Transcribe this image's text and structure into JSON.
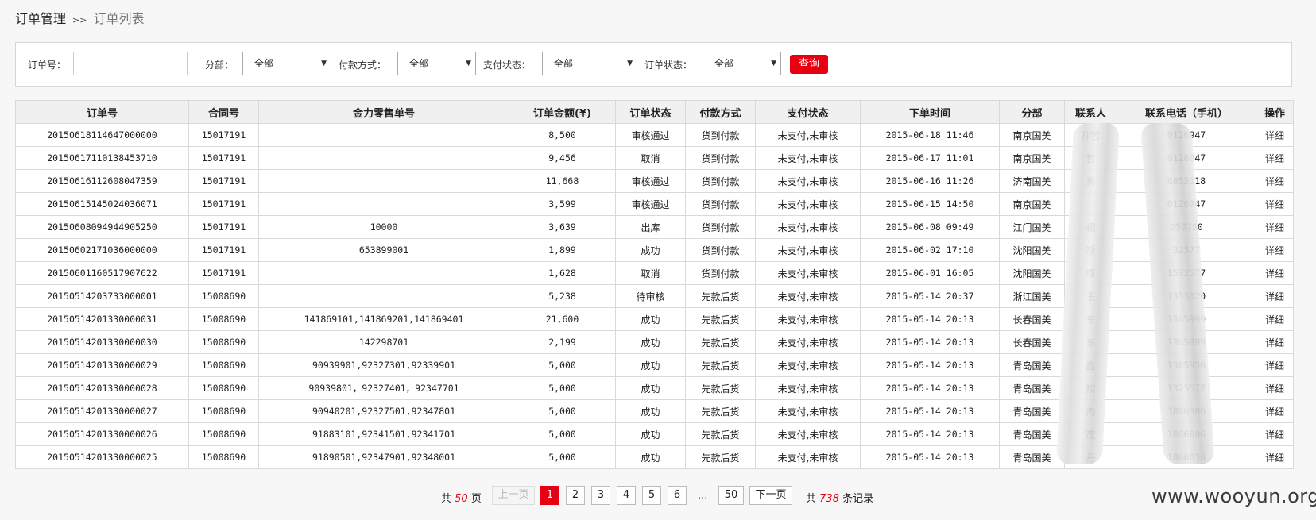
{
  "breadcrumb": {
    "parent": "订单管理",
    "separator": ">>",
    "current": "订单列表"
  },
  "filters": {
    "order_no_label": "订单号：",
    "order_no_value": "",
    "branch_label": "分部：",
    "branch_value": "全部",
    "payment_method_label": "付款方式：",
    "payment_method_value": "全部",
    "pay_status_label": "支付状态：",
    "pay_status_value": "全部",
    "order_status_label": "订单状态：",
    "order_status_value": "全部",
    "search_label": "查询"
  },
  "table": {
    "headers": [
      "订单号",
      "合同号",
      "金力零售单号",
      "订单金额(¥)",
      "订单状态",
      "付款方式",
      "支付状态",
      "下单时间",
      "分部",
      "联系人",
      "联系电话（手机）",
      "操作"
    ],
    "rows": [
      [
        "20150618114647000000",
        "15017191",
        "",
        "8,500",
        "审核通过",
        "货到付款",
        "未支付,未审核",
        "2015-06-18 11:46",
        "南京国美",
        "孙哲",
        "0126947",
        "详细"
      ],
      [
        "20150617110138453710",
        "15017191",
        "",
        "9,456",
        "取消",
        "货到付款",
        "未支付,未审核",
        "2015-06-17 11:01",
        "南京国美",
        "哲",
        "0126947",
        "详细"
      ],
      [
        "20150616112608047359",
        "15017191",
        "",
        "11,668",
        "审核通过",
        "货到付款",
        "未支付,未审核",
        "2015-06-16 11:26",
        "济南国美",
        "秀",
        "6853118",
        "详细"
      ],
      [
        "20150615145024036071",
        "15017191",
        "",
        "3,599",
        "审核通过",
        "货到付款",
        "未支付,未审核",
        "2015-06-15 14:50",
        "南京国美",
        "",
        "0126947",
        "详细"
      ],
      [
        "20150608094944905250",
        "15017191",
        "10000",
        "3,639",
        "出库",
        "货到付款",
        "未支付,未审核",
        "2015-06-08 09:49",
        "江门国美",
        "禤",
        "050730",
        "详细"
      ],
      [
        "20150602171036000000",
        "15017191",
        "653899001",
        "1,899",
        "成功",
        "货到付款",
        "未支付,未审核",
        "2015-06-02 17:10",
        "沈阳国美",
        "项",
        "32577",
        "详细"
      ],
      [
        "20150601160517907622",
        "15017191",
        "",
        "1,628",
        "取消",
        "货到付款",
        "未支付,未审核",
        "2015-06-01 16:05",
        "沈阳国美",
        "项",
        "1532577",
        "详细"
      ],
      [
        "20150514203733000001",
        "15008690",
        "",
        "5,238",
        "待审核",
        "先款后货",
        "未支付,未审核",
        "2015-05-14 20:37",
        "浙江国美",
        "王",
        "1353020",
        "详细"
      ],
      [
        "20150514201330000031",
        "15008690",
        "141869101,141869201,141869401",
        "21,600",
        "成功",
        "先款后货",
        "未支付,未审核",
        "2015-05-14 20:13",
        "长春国美",
        "东",
        "1365999",
        "详细"
      ],
      [
        "20150514201330000030",
        "15008690",
        "142298701",
        "2,199",
        "成功",
        "先款后货",
        "未支付,未审核",
        "2015-05-14 20:13",
        "长春国美",
        "东",
        "1365999",
        "详细"
      ],
      [
        "20150514201330000029",
        "15008690",
        "90939901,92327301,92339901",
        "5,000",
        "成功",
        "先款后货",
        "未支付,未审核",
        "2015-05-14 20:13",
        "青岛国美",
        "鑫",
        "1385950",
        "详细"
      ],
      [
        "20150514201330000028",
        "15008690",
        "90939801，92327401，92347701",
        "5,000",
        "成功",
        "先款后货",
        "未支付,未审核",
        "2015-05-14 20:13",
        "青岛国美",
        "斌",
        "1325577",
        "详细"
      ],
      [
        "20150514201330000027",
        "15008690",
        "90940201,92327501,92347801",
        "5,000",
        "成功",
        "先款后货",
        "未支付,未审核",
        "2015-05-14 20:13",
        "青岛国美",
        "杰",
        "1866306",
        "详细"
      ],
      [
        "20150514201330000026",
        "15008690",
        "91883101,92341501,92341701",
        "5,000",
        "成功",
        "先款后货",
        "未支付,未审核",
        "2015-05-14 20:13",
        "青岛国美",
        "茂",
        "1866006",
        "详细"
      ],
      [
        "20150514201330000025",
        "15008690",
        "91890501,92347901,92348001",
        "5,000",
        "成功",
        "先款后货",
        "未支付,未审核",
        "2015-05-14 20:13",
        "青岛国美",
        "丹",
        "1866036",
        "详细"
      ]
    ]
  },
  "pagination": {
    "total_pages_prefix": "共",
    "total_pages": "50",
    "total_pages_suffix": "页",
    "prev_label": "上一页",
    "pages": [
      "1",
      "2",
      "3",
      "4",
      "5",
      "6"
    ],
    "ellipsis": "...",
    "last_page": "50",
    "next_label": "下一页",
    "total_records_prefix": "共",
    "total_records": "738",
    "total_records_suffix": "条记录"
  },
  "watermark": "www.wooyun.org",
  "colors": {
    "accent": "#e60012",
    "header_bg": "#f0f0f0",
    "page_bg": "#f7f7f7",
    "border": "#d9d9d9"
  }
}
